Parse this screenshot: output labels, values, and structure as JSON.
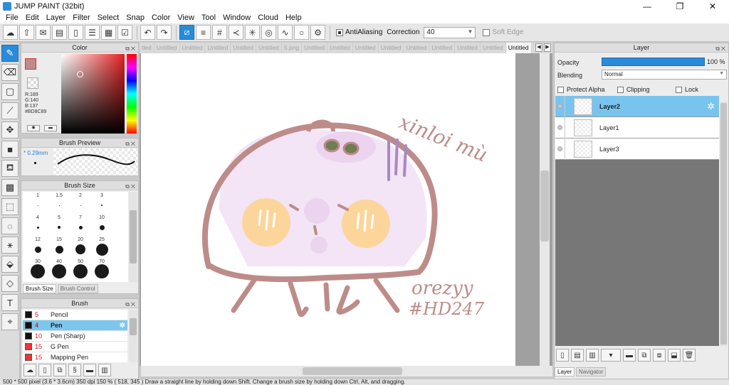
{
  "app": {
    "title": "JUMP PAINT (32bit)"
  },
  "window_buttons": {
    "minimize": "—",
    "maximize": "❐",
    "close": "✕"
  },
  "menu": [
    "File",
    "Edit",
    "Layer",
    "Filter",
    "Select",
    "Snap",
    "Color",
    "View",
    "Tool",
    "Window",
    "Cloud",
    "Help"
  ],
  "toolbar": {
    "antialiasing_label": "AntiAliasing",
    "antialiasing_checked": true,
    "correction_label": "Correction",
    "correction_value": "40",
    "soft_edge_label": "Soft Edge",
    "soft_edge_checked": false
  },
  "color_panel": {
    "title": "Color",
    "rgb_r": "R:189",
    "rgb_g": "G:140",
    "rgb_b": "B:137",
    "hex": "#BD8C89",
    "main_color": "#BD8C89",
    "sub_color": "#FFFFFF"
  },
  "brush_preview": {
    "title": "Brush Preview",
    "size": "0.29mm"
  },
  "brush_size": {
    "title": "Brush Size",
    "sizes": [
      {
        "label": "1",
        "dot": 1
      },
      {
        "label": "1.5",
        "dot": 1
      },
      {
        "label": "2",
        "dot": 1
      },
      {
        "label": "3",
        "dot": 2
      },
      {
        "label": "4",
        "dot": 3
      },
      {
        "label": "5",
        "dot": 4
      },
      {
        "label": "7",
        "dot": 5
      },
      {
        "label": "10",
        "dot": 7
      },
      {
        "label": "12",
        "dot": 9
      },
      {
        "label": "15",
        "dot": 11
      },
      {
        "label": "20",
        "dot": 14
      },
      {
        "label": "25",
        "dot": 17
      },
      {
        "label": "30",
        "dot": 20
      },
      {
        "label": "40",
        "dot": 20
      },
      {
        "label": "50",
        "dot": 20
      },
      {
        "label": "70",
        "dot": 20
      }
    ],
    "tab_size": "Brush Size",
    "tab_control": "Brush Control"
  },
  "brush_panel": {
    "title": "Brush",
    "items": [
      {
        "num": "5",
        "name": "Pencil",
        "swatch": "black",
        "selected": false
      },
      {
        "num": "4",
        "name": "Pen",
        "swatch": "black",
        "selected": true
      },
      {
        "num": "10",
        "name": "Pen (Sharp)",
        "swatch": "black",
        "selected": false
      },
      {
        "num": "15",
        "name": "G Pen",
        "swatch": "red",
        "selected": false
      },
      {
        "num": "15",
        "name": "Mapping Pen",
        "swatch": "red",
        "selected": false
      }
    ]
  },
  "doc_tabs": [
    "tled",
    "Untitled",
    "Untitled",
    "Untitled",
    "Untitled",
    "Untitled",
    "5.png",
    "Untitled",
    "Untitled",
    "Untitled",
    "Untitled",
    "Untitled",
    "Untitled",
    "Untitled",
    "Untitled",
    "Untitled"
  ],
  "active_doc_tab_index": 15,
  "canvas": {
    "text_top": "xinloi mù",
    "text_bottom_1": "orezyy",
    "text_bottom_2": "#HD247",
    "stroke_color": "#BD8C89"
  },
  "layer_panel": {
    "title": "Layer",
    "opacity_label": "Opacity",
    "opacity_value": "100 %",
    "opacity_fraction": 1.0,
    "blending_label": "Blending",
    "blending_value": "Normal",
    "protect_alpha_label": "Protect Alpha",
    "clipping_label": "Clipping",
    "lock_label": "Lock",
    "layers": [
      {
        "name": "Layer2",
        "selected": true
      },
      {
        "name": "Layer1",
        "selected": false
      },
      {
        "name": "Layer3",
        "selected": false
      }
    ],
    "tab_layer": "Layer",
    "tab_navigator": "Navigator"
  },
  "status": "500 * 500 pixel   (3.6 * 3.6cm)   350 dpi   150 %   ( 518, 345 )   Draw a straight line by holding down Shift. Change a brush size by holding down Ctrl, Alt, and dragging."
}
